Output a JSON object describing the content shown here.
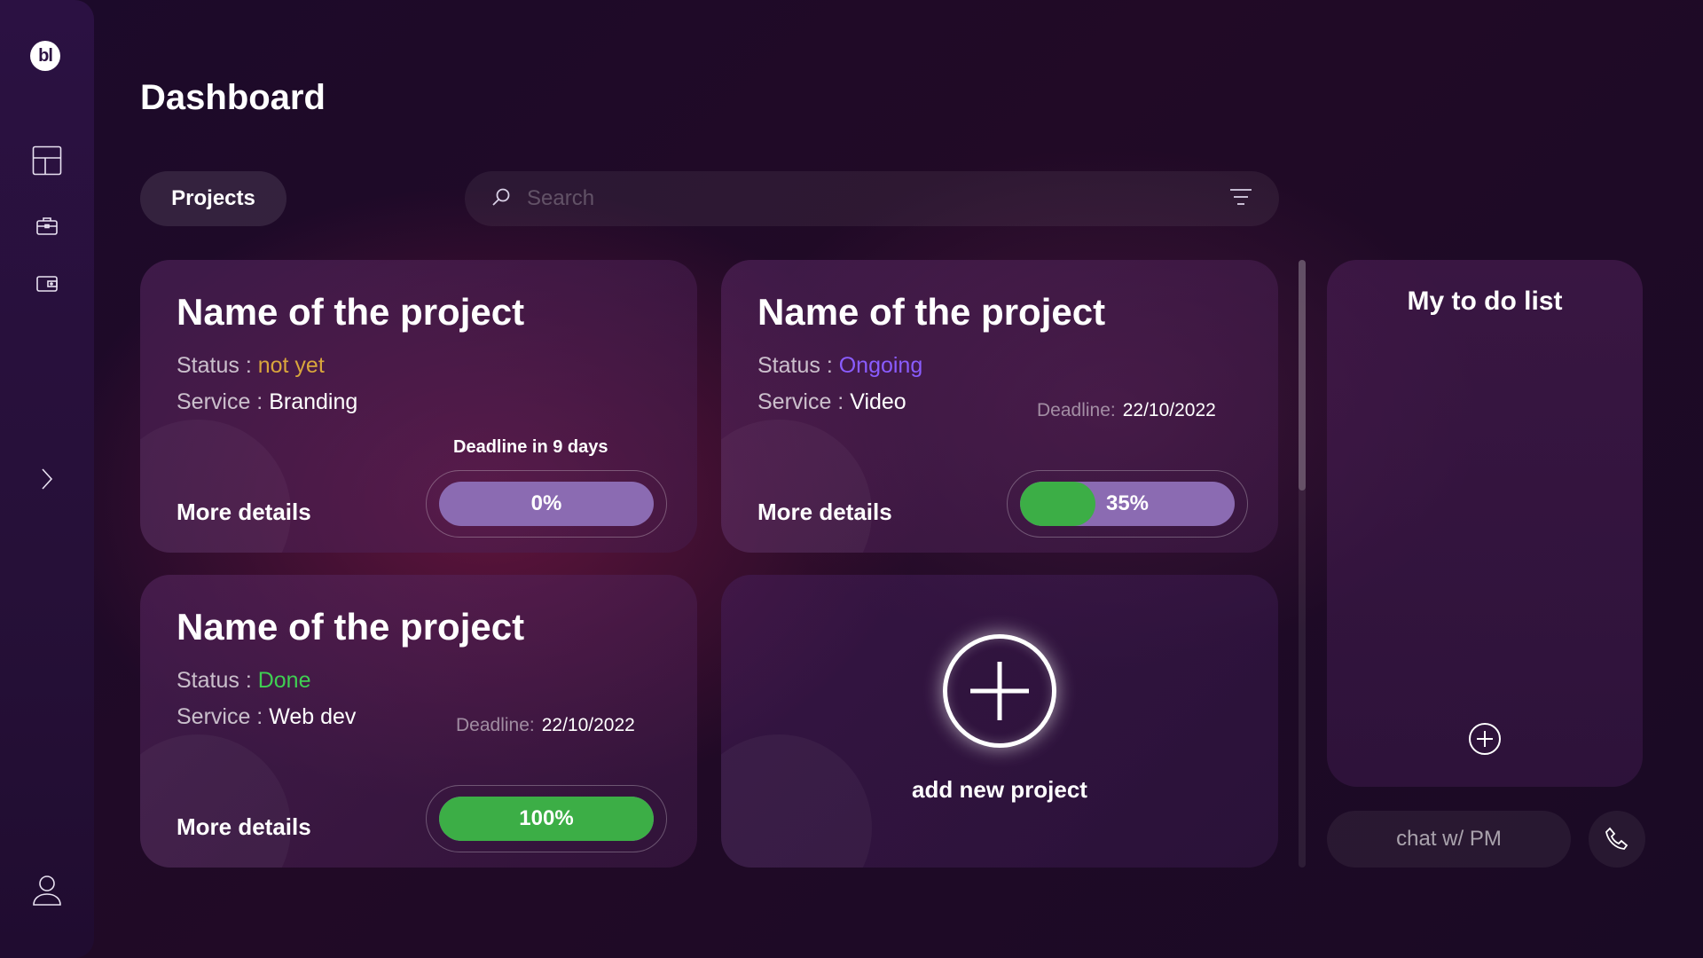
{
  "sidebar": {
    "logo_text": "bl",
    "icons": [
      "layout-icon",
      "briefcase-icon",
      "wallet-icon",
      "chevron-right-icon",
      "user-icon"
    ]
  },
  "header": {
    "title": "Dashboard",
    "projects_tab": "Projects",
    "search_placeholder": "Search"
  },
  "projects": [
    {
      "title": "Name of the project",
      "status_label": "Status :",
      "status": "not yet",
      "service_label": "Service :",
      "service": "Branding",
      "deadline_text": "Deadline in 9 days",
      "more": "More details",
      "progress": 0,
      "progress_label": "0%"
    },
    {
      "title": "Name of the project",
      "status_label": "Status :",
      "status": "Ongoing",
      "service_label": "Service :",
      "service": "Video",
      "deadline_label": "Deadline:",
      "deadline": "22/10/2022",
      "more": "More details",
      "progress": 35,
      "progress_label": "35%"
    },
    {
      "title": "Name of the project",
      "status_label": "Status :",
      "status": "Done",
      "service_label": "Service :",
      "service": "Web dev",
      "deadline_label": "Deadline:",
      "deadline": "22/10/2022",
      "more": "More details",
      "progress": 100,
      "progress_label": "100%"
    }
  ],
  "add_project": {
    "label": "add new project"
  },
  "todo": {
    "title": "My to do list"
  },
  "chat": {
    "label": "chat w/ PM"
  },
  "colors": {
    "accent_green": "#3cae46",
    "status_not_yet": "#d9a63c",
    "status_ongoing": "#8a5cff",
    "status_done": "#3fcf52",
    "progress_track": "#8b6bb2"
  }
}
